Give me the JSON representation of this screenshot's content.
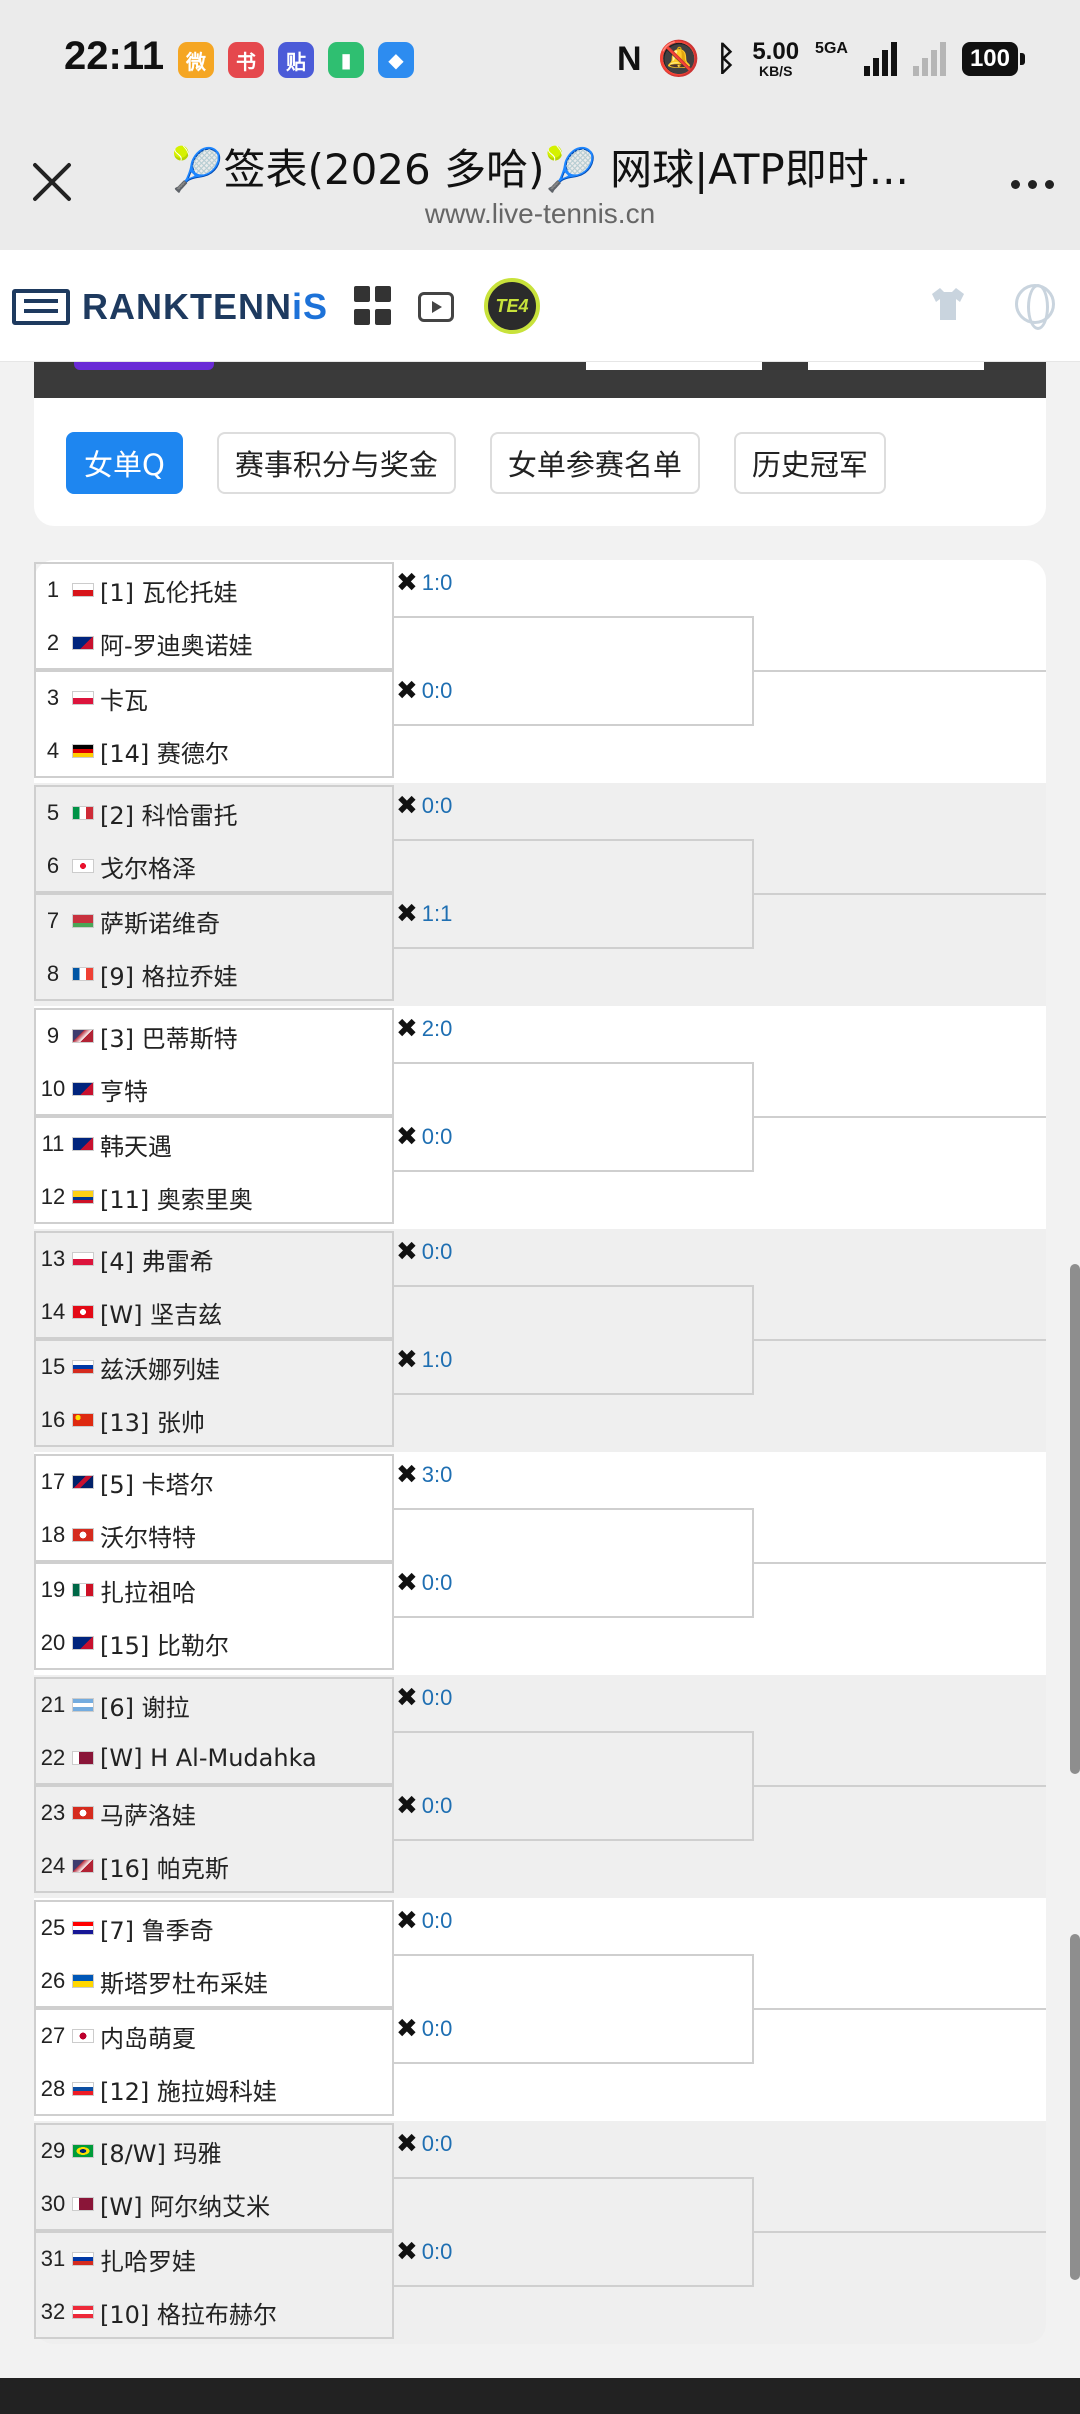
{
  "status_bar": {
    "time": "22:11",
    "apps": [
      {
        "icon": "weibo-icon",
        "glyph": "微",
        "color": "#f5a623"
      },
      {
        "icon": "redbook-icon",
        "glyph": "书",
        "color": "#e5484d"
      },
      {
        "icon": "tieba-icon",
        "glyph": "贴",
        "color": "#4b5bd8"
      },
      {
        "icon": "battery-app-icon",
        "glyph": "▮",
        "color": "#2fbf71"
      },
      {
        "icon": "browser-app-icon",
        "glyph": "◆",
        "color": "#2d8cf0"
      }
    ],
    "speed_value": "5.00",
    "speed_unit": "KB/S",
    "network": "5GA",
    "battery": "100"
  },
  "browser": {
    "title": "🎾签表(2026 多哈)🎾 网球|ATP即时...",
    "url": "www.live-tennis.cn"
  },
  "site": {
    "logo_main": "RANKTENN",
    "logo_accent": "iS",
    "badge": "TE4"
  },
  "tabs": [
    {
      "label": "女单Q",
      "active": true
    },
    {
      "label": "赛事积分与奖金",
      "active": false
    },
    {
      "label": "女单参赛名单",
      "active": false
    },
    {
      "label": "历史冠军",
      "active": false
    }
  ],
  "colors": {
    "accent": "#1e86f0",
    "score": "#1f6fb2",
    "logo": "#1e3a5f"
  },
  "bracket": [
    {
      "matches": [
        {
          "score": "1:0",
          "players": [
            {
              "no": "1",
              "flag": "cz",
              "name": "[1] 瓦伦托娃"
            },
            {
              "no": "2",
              "flag": "au",
              "name": "阿-罗迪奥诺娃"
            }
          ]
        },
        {
          "score": "0:0",
          "players": [
            {
              "no": "3",
              "flag": "pl",
              "name": "卡瓦"
            },
            {
              "no": "4",
              "flag": "de",
              "name": "[14] 赛德尔"
            }
          ]
        }
      ]
    },
    {
      "matches": [
        {
          "score": "0:0",
          "players": [
            {
              "no": "5",
              "flag": "it",
              "name": "[2] 科恰雷托"
            },
            {
              "no": "6",
              "flag": "ge",
              "name": "戈尔格泽"
            }
          ]
        },
        {
          "score": "1:1",
          "players": [
            {
              "no": "7",
              "flag": "by",
              "name": "萨斯诺维奇"
            },
            {
              "no": "8",
              "flag": "fr",
              "name": "[9] 格拉乔娃"
            }
          ]
        }
      ]
    },
    {
      "matches": [
        {
          "score": "2:0",
          "players": [
            {
              "no": "9",
              "flag": "us",
              "name": "[3] 巴蒂斯特"
            },
            {
              "no": "10",
              "flag": "au",
              "name": "亨特"
            }
          ]
        },
        {
          "score": "0:0",
          "players": [
            {
              "no": "11",
              "flag": "au",
              "name": "韩天遇"
            },
            {
              "no": "12",
              "flag": "co",
              "name": "[11] 奥索里奥"
            }
          ]
        }
      ]
    },
    {
      "matches": [
        {
          "score": "0:0",
          "players": [
            {
              "no": "13",
              "flag": "pl",
              "name": "[4] 弗雷希"
            },
            {
              "no": "14",
              "flag": "tr",
              "name": "[W] 坚吉兹"
            }
          ]
        },
        {
          "score": "1:0",
          "players": [
            {
              "no": "15",
              "flag": "ru",
              "name": "兹沃娜列娃"
            },
            {
              "no": "16",
              "flag": "cn",
              "name": "[13] 张帅"
            }
          ]
        }
      ]
    },
    {
      "matches": [
        {
          "score": "3:0",
          "players": [
            {
              "no": "17",
              "flag": "gb",
              "name": "[5] 卡塔尔"
            },
            {
              "no": "18",
              "flag": "ch",
              "name": "沃尔特特"
            }
          ]
        },
        {
          "score": "0:0",
          "players": [
            {
              "no": "19",
              "flag": "mx",
              "name": "扎拉祖哈"
            },
            {
              "no": "20",
              "flag": "au",
              "name": "[15] 比勒尔"
            }
          ]
        }
      ]
    },
    {
      "matches": [
        {
          "score": "0:0",
          "players": [
            {
              "no": "21",
              "flag": "ar",
              "name": "[6] 谢拉"
            },
            {
              "no": "22",
              "flag": "qa",
              "name": "[W] H Al-Mudahka"
            }
          ]
        },
        {
          "score": "0:0",
          "players": [
            {
              "no": "23",
              "flag": "ch",
              "name": "马萨洛娃"
            },
            {
              "no": "24",
              "flag": "us",
              "name": "[16] 帕克斯"
            }
          ]
        }
      ]
    },
    {
      "matches": [
        {
          "score": "0:0",
          "players": [
            {
              "no": "25",
              "flag": "hr",
              "name": "[7] 鲁季奇"
            },
            {
              "no": "26",
              "flag": "ua",
              "name": "斯塔罗杜布采娃"
            }
          ]
        },
        {
          "score": "0:0",
          "players": [
            {
              "no": "27",
              "flag": "jp",
              "name": "内岛萌夏"
            },
            {
              "no": "28",
              "flag": "sk",
              "name": "[12] 施拉姆科娃"
            }
          ]
        }
      ]
    },
    {
      "matches": [
        {
          "score": "0:0",
          "players": [
            {
              "no": "29",
              "flag": "br",
              "name": "[8/W] 玛雅"
            },
            {
              "no": "30",
              "flag": "qa",
              "name": "[W] 阿尔纳艾米"
            }
          ]
        },
        {
          "score": "0:0",
          "players": [
            {
              "no": "31",
              "flag": "ru",
              "name": "扎哈罗娃"
            },
            {
              "no": "32",
              "flag": "at",
              "name": "[10] 格拉布赫尔"
            }
          ]
        }
      ]
    }
  ]
}
